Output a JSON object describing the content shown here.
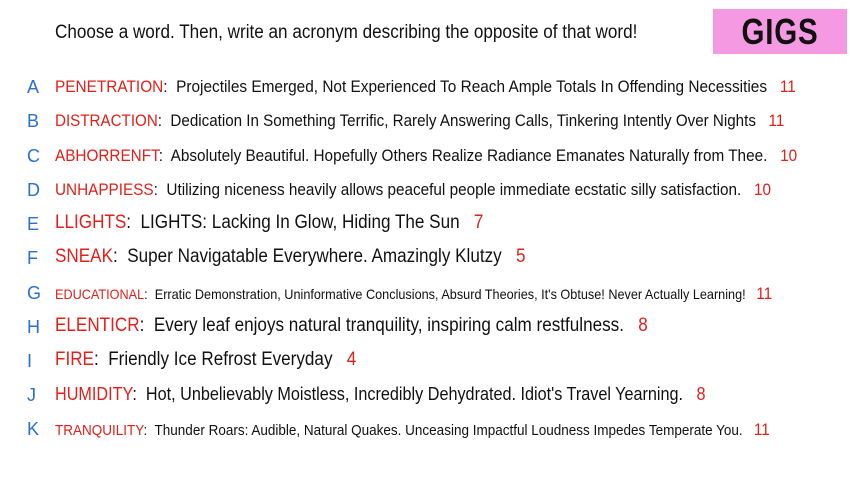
{
  "prompt": "Choose a word. Then, write an acronym describing the opposite of that word!",
  "badge": "GIGS",
  "rows": [
    {
      "letter": "A",
      "word": "PENETRATION",
      "acronym": "Projectiles Emerged, Not Experienced To Reach Ample Totals In Offending Necessities",
      "score": "11"
    },
    {
      "letter": "B",
      "word": "DISTRACTION",
      "acronym": "Dedication In Something Terrific, Rarely Answering Calls, Tinkering Intently Over Nights",
      "score": "11"
    },
    {
      "letter": "C",
      "word": "ABHORRENFT",
      "acronym": "Absolutely Beautiful. Hopefully Others Realize Radiance Emanates Naturally from Thee.",
      "score": "10"
    },
    {
      "letter": "D",
      "word": "UNHAPPIESS",
      "acronym": "Utilizing niceness heavily allows peaceful people immediate ecstatic silly satisfaction.",
      "score": "10"
    },
    {
      "letter": "E",
      "word": "LLIGHTS",
      "acronym": "LIGHTS: Lacking In Glow, Hiding The Sun",
      "score": "7"
    },
    {
      "letter": "F",
      "word": "SNEAK",
      "acronym": "Super Navigatable Everywhere. Amazingly Klutzy",
      "score": "5"
    },
    {
      "letter": "G",
      "word": "EDUCATIONAL",
      "acronym": "Erratic Demonstration, Uninformative Conclusions, Absurd Theories, It's Obtuse! Never Actually Learning!",
      "score": "11"
    },
    {
      "letter": "H",
      "word": "ELENTICR",
      "acronym": "Every leaf enjoys natural tranquility, inspiring calm restfulness.",
      "score": "8"
    },
    {
      "letter": "I",
      "word": "FIRE",
      "acronym": "Friendly Ice Refrost Everyday",
      "score": "4"
    },
    {
      "letter": "J",
      "word": "HUMIDITY",
      "acronym": "Hot, Unbelievably Moistless, Incredibly Dehydrated. Idiot's Travel Yearning.",
      "score": "8"
    },
    {
      "letter": "K",
      "word": "TRANQUILITY",
      "acronym": "Thunder Roars: Audible, Natural Quakes. Unceasing Impactful Loudness Impedes Temperate You.",
      "score": "11"
    }
  ]
}
